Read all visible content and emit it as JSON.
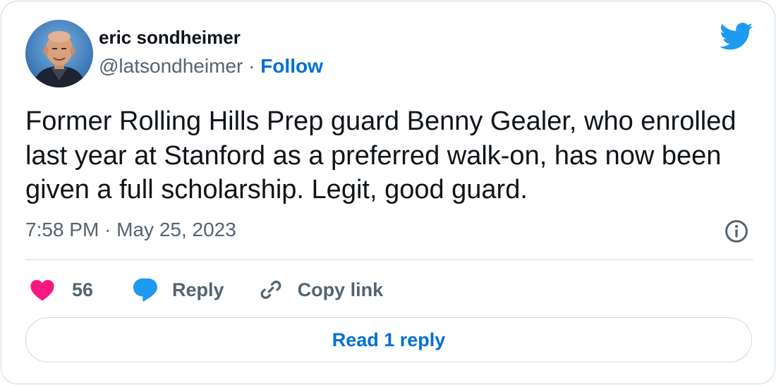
{
  "author": {
    "name": "eric sondheimer",
    "handle": "@latsondheimer",
    "separator": "·",
    "follow_label": "Follow"
  },
  "tweet": {
    "text": "Former Rolling Hills Prep guard Benny Gealer, who enrolled last year at Stanford as a preferred walk-on, has now been given a full scholarship. Legit, good guard.",
    "timestamp": "7:58 PM · May 25, 2023"
  },
  "actions": {
    "like_count": "56",
    "reply_label": "Reply",
    "copy_link_label": "Copy link"
  },
  "read_reply_label": "Read 1 reply",
  "icons": {
    "brand": "twitter-bird-icon",
    "info": "info-icon",
    "like": "heart-icon",
    "reply": "speech-bubble-icon",
    "copy": "link-icon"
  },
  "colors": {
    "twitter_blue": "#1d9bf0",
    "link_blue": "#006fd6",
    "like_pink": "#f91880",
    "text_primary": "#0f1419",
    "text_secondary": "#536471",
    "border": "#cfd9de"
  }
}
